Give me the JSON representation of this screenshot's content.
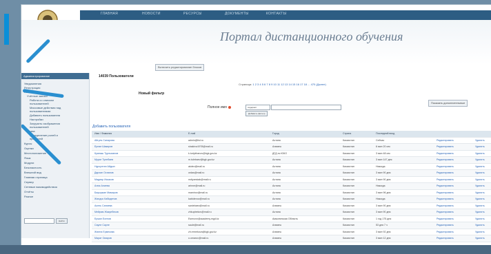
{
  "portal_title": "Портал дистанционного обучения",
  "top_nav": [
    "ГЛАВНАЯ",
    "НОВОСТИ",
    "РЕСУРСЫ",
    "ДОКУМЕНТЫ",
    "КОНТАКТЫ"
  ],
  "mode_button": "Включить редактирование блоков",
  "sidebar": {
    "header": "Администрирование",
    "items": [
      "Уведомления",
      "Регистрация",
      "Пользователи",
      "Учётные записи",
      "Работа со списком",
      "пользователей",
      "Массовые действия над",
      "пользователями",
      "Добавить пользователя",
      "Настройки",
      "Загрузить изображения",
      "пользователей",
      "Права",
      "Определение ролей и",
      "профилей",
      "Курсы",
      "Оценки",
      "Местоположение",
      "Язык",
      "Модули",
      "Безопасность",
      "Внешний вид",
      "Главная страница",
      "Сервер",
      "Сетевые взаимодействия",
      "Отчёты",
      "Разное"
    ],
    "search_button": "Найти"
  },
  "users_count": "14039 Пользователи",
  "pager": {
    "label": "Страница:",
    "pages": "1 2 3 4 5 6 7 8 9 10 11 12 13 14 15 16 17 18 ... 470",
    "next": "(Далее)"
  },
  "filter": {
    "heading": "Новый фильтр",
    "field_label": "Полное имя",
    "operator": "содержит",
    "add_button": "Добавить фильтр",
    "advanced_button": "Показать дополнительные"
  },
  "add_user_link": "Добавить пользователя",
  "table": {
    "columns": [
      "Имя / Фамилия",
      "E-mail",
      "Город",
      "Страна",
      "Последний вход",
      "",
      ""
    ],
    "rows": [
      [
        "Айгуль Сапарова",
        "admin@list.ru",
        "Астана",
        "Казахстан",
        "Сейчас",
        "Редактировать",
        "Удалить"
      ],
      [
        "Ерлан Шакиров",
        "shakirov1978@mail.ru",
        "Алматы",
        "Казахстан",
        "6 мин 20 сек",
        "Редактировать",
        "Удалить"
      ],
      [
        "Куаныш Турлыханов",
        "k.turlykhanov@kgk.gov.kz",
        "ДГД по ЮКО",
        "Казахстан",
        "3 мин 48 сек",
        "Редактировать",
        "Удалить"
      ],
      [
        "Мурат Тулебаев",
        "m.tulebaev@kgk.gov.kz",
        "Астана",
        "Казахстан",
        "3 мин 147 дня",
        "Редактировать",
        "Удалить"
      ],
      [
        "Нурсултан Айдын",
        "akdev@mail.ru",
        "Астана",
        "Казахстан",
        "Никогда",
        "Редактировать",
        "Удалить"
      ],
      [
        "Дархан Оспанов",
        "ordas@mail.ru",
        "Астана",
        "Казахстан",
        "3 мин 90 дня",
        "Редактировать",
        "Удалить"
      ],
      [
        "Мадияр Искаков",
        "mdiyarskak@mail.ru",
        "Астана",
        "Казахстан",
        "3 мин 90 дня",
        "Редактировать",
        "Удалить"
      ],
      [
        "Алия Алиева",
        "arinne@mail.ru",
        "Астана",
        "Казахстан",
        "Никогда",
        "Редактировать",
        "Удалить"
      ],
      [
        "Бауыржан Мамиров",
        "mamirov@mail.ru",
        "Астана",
        "Казахстан",
        "3 мин 96 дня",
        "Редактировать",
        "Удалить"
      ],
      [
        "Жандос Кабиденов",
        "kabidenov@mail.ru",
        "Астана",
        "Казахстан",
        "Никогда",
        "Редактировать",
        "Удалить"
      ],
      [
        "Асель Саниева",
        "saniebaev@mail.ru",
        "Алматы",
        "Казахстан",
        "3 мин 90 дня",
        "Редактировать",
        "Удалить"
      ],
      [
        "Мейрам Жакупбеков",
        "zhkupbekov@mail.ru",
        "Астана",
        "Казахстан",
        "3 мин 90 дня",
        "Редактировать",
        "Удалить"
      ],
      [
        "Ержан Есенов",
        "Esenovn@academy.mgd.kz",
        "Акмолинская Область",
        "Казахстан",
        "1 год 175 дня",
        "Редактировать",
        "Удалить"
      ],
      [
        "Сауле Сауле",
        "saule@mail.ru",
        "Алматы",
        "Казахстан",
        "53 дня 7 ч",
        "Редактировать",
        "Удалить"
      ],
      [
        "Жанна Ермекова",
        "zh.ermekova@kgk.gov.kz",
        "Алматы",
        "Казахстан",
        "3 мин 92 дня",
        "Редактировать",
        "Удалить"
      ],
      [
        "Марат Омаров",
        "o.omarov@mail.ru",
        "Алматы",
        "Казахстан",
        "3 мин 12 дня",
        "Редактировать",
        "Удалить"
      ]
    ]
  }
}
